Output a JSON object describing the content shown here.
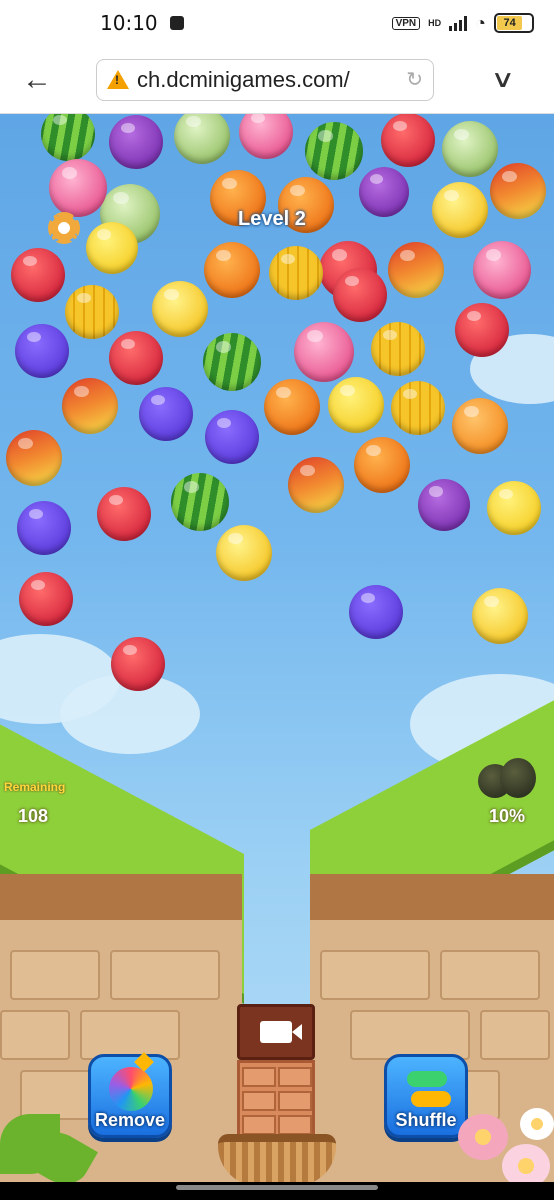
{
  "status_bar": {
    "time": "10:10",
    "vpn": "VPN",
    "hd": "HD",
    "battery": "74",
    "icons": [
      "notification-icon",
      "vpn-icon",
      "signal-icon",
      "wifi-icon",
      "battery-icon"
    ]
  },
  "browser": {
    "url": "ch.dcminigames.com/",
    "back_icon": "back-arrow-icon",
    "security_icon": "warning-icon",
    "reload_icon": "reload-icon",
    "menu_icon": "chevron-down-icon"
  },
  "game": {
    "level": "Level 2",
    "remaining_label": "Remaining",
    "remaining_value": "108",
    "progress_percent": "10%",
    "remove_label": "Remove",
    "shuffle_label": "Shuffle",
    "icons": [
      "settings-icon",
      "durian-icon",
      "video-icon",
      "bomb-icon",
      "shuffle-icon"
    ],
    "fruits": [
      "watermelon",
      "grapes",
      "cabbage",
      "dragonfruit",
      "strawberry",
      "watermelon",
      "strawberry",
      "cabbage",
      "dragonfruit",
      "cabbage",
      "persimmon",
      "persimmon",
      "grapes",
      "lemon",
      "peach",
      "banana",
      "strawberry",
      "persimmon",
      "starfruit",
      "peach",
      "dragonfruit",
      "starfruit",
      "lemon",
      "strawberry",
      "strawberry",
      "blueberry",
      "strawberry",
      "watermelon",
      "dragonfruit",
      "starfruit",
      "peach",
      "blueberry",
      "blueberry",
      "persimmon",
      "banana",
      "starfruit",
      "orange",
      "peach",
      "peach",
      "persimmon",
      "blueberry",
      "strawberry",
      "watermelon",
      "grapes",
      "banana",
      "lemon",
      "strawberry",
      "blueberry",
      "lemon",
      "strawberry"
    ]
  }
}
